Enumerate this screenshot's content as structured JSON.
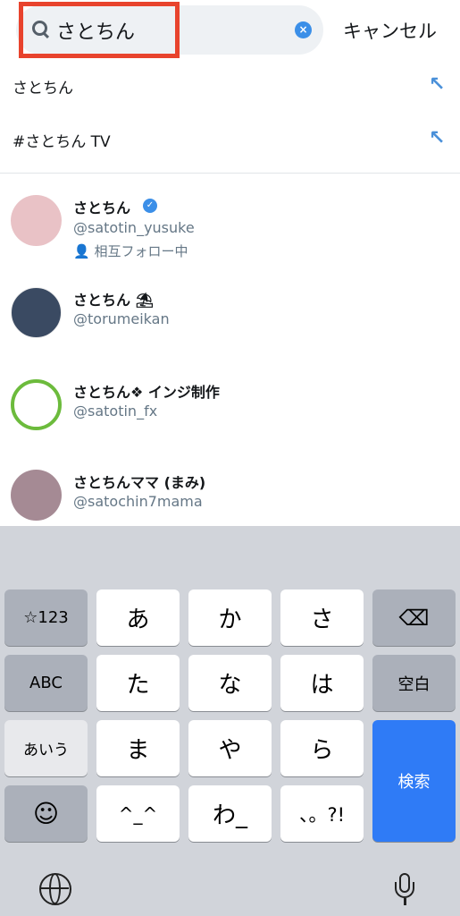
{
  "search": {
    "query": "さとちん",
    "cancel": "キャンセル",
    "clear_icon": "clear-icon",
    "accent": "#3b8fe8"
  },
  "suggestions": [
    {
      "text": "さとちん"
    },
    {
      "text": "#さとちん TV"
    }
  ],
  "users": [
    {
      "name": "さとちん",
      "verified": true,
      "handle": "@satotin_yusuke",
      "meta": "相互フォロー中"
    },
    {
      "name": "さとちん",
      "emoji": "⛱",
      "handle": "@torumeikan"
    },
    {
      "name": "さとちん❖ インジ制作",
      "handle": "@satotin_fx"
    },
    {
      "name": "さとちんママ (まみ)",
      "handle": "@satochin7mama"
    }
  ],
  "keyboard": {
    "rows": [
      [
        "☆123",
        "あ",
        "か",
        "さ",
        "⌫"
      ],
      [
        "ABC",
        "た",
        "な",
        "は",
        "空白"
      ],
      [
        "あいう",
        "ま",
        "や",
        "ら",
        "検索"
      ],
      [
        "☺",
        "^_^",
        "わ_",
        "、。?!"
      ]
    ],
    "globe": "globe-icon",
    "mic": "mic-icon"
  }
}
